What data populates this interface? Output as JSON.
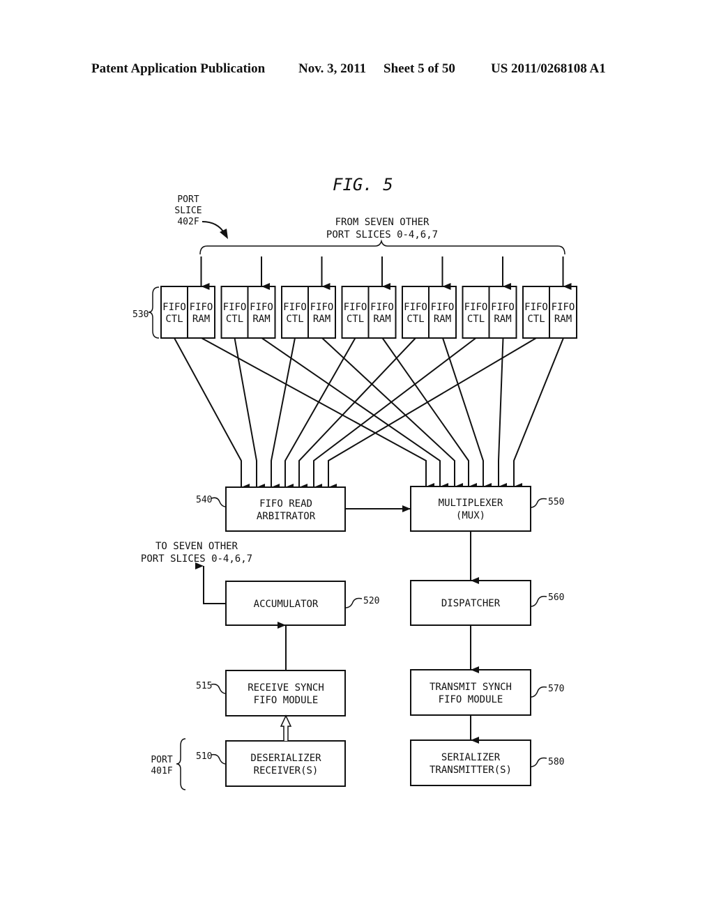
{
  "header": {
    "publication": "Patent Application Publication",
    "date": "Nov. 3, 2011",
    "sheet": "Sheet 5 of 50",
    "number": "US 2011/0268108 A1"
  },
  "figure": {
    "title": "FIG. 5",
    "port_slice_label": [
      "PORT",
      "SLICE",
      "402F"
    ],
    "from_label": [
      "FROM SEVEN OTHER",
      "PORT SLICES 0-4,6,7"
    ],
    "fifo_group_ref": "530",
    "fifo_pairs": [
      {
        "ctl": [
          "FIFO",
          "CTL"
        ],
        "ram": [
          "FIFO",
          "RAM"
        ]
      },
      {
        "ctl": [
          "FIFO",
          "CTL"
        ],
        "ram": [
          "FIFO",
          "RAM"
        ]
      },
      {
        "ctl": [
          "FIFO",
          "CTL"
        ],
        "ram": [
          "FIFO",
          "RAM"
        ]
      },
      {
        "ctl": [
          "FIFO",
          "CTL"
        ],
        "ram": [
          "FIFO",
          "RAM"
        ]
      },
      {
        "ctl": [
          "FIFO",
          "CTL"
        ],
        "ram": [
          "FIFO",
          "RAM"
        ]
      },
      {
        "ctl": [
          "FIFO",
          "CTL"
        ],
        "ram": [
          "FIFO",
          "RAM"
        ]
      },
      {
        "ctl": [
          "FIFO",
          "CTL"
        ],
        "ram": [
          "FIFO",
          "RAM"
        ]
      }
    ],
    "blocks": {
      "arbitrator": {
        "ref": "540",
        "lines": [
          "FIFO READ",
          "ARBITRATOR"
        ]
      },
      "mux": {
        "ref": "550",
        "lines": [
          "MULTIPLEXER",
          "(MUX)"
        ]
      },
      "accumulator": {
        "ref": "520",
        "lines": [
          "ACCUMULATOR"
        ]
      },
      "dispatcher": {
        "ref": "560",
        "lines": [
          "DISPATCHER"
        ]
      },
      "rx_synch": {
        "ref": "515",
        "lines": [
          "RECEIVE SYNCH",
          "FIFO MODULE"
        ]
      },
      "tx_synch": {
        "ref": "570",
        "lines": [
          "TRANSMIT SYNCH",
          "FIFO MODULE"
        ]
      },
      "deserializer": {
        "ref": "510",
        "lines": [
          "DESERIALIZER",
          "RECEIVER(S)"
        ]
      },
      "serializer": {
        "ref": "580",
        "lines": [
          "SERIALIZER",
          "TRANSMITTER(S)"
        ]
      }
    },
    "to_label": [
      "TO SEVEN OTHER",
      "PORT SLICES 0-4,6,7"
    ],
    "port_label": [
      "PORT",
      "401F"
    ]
  }
}
